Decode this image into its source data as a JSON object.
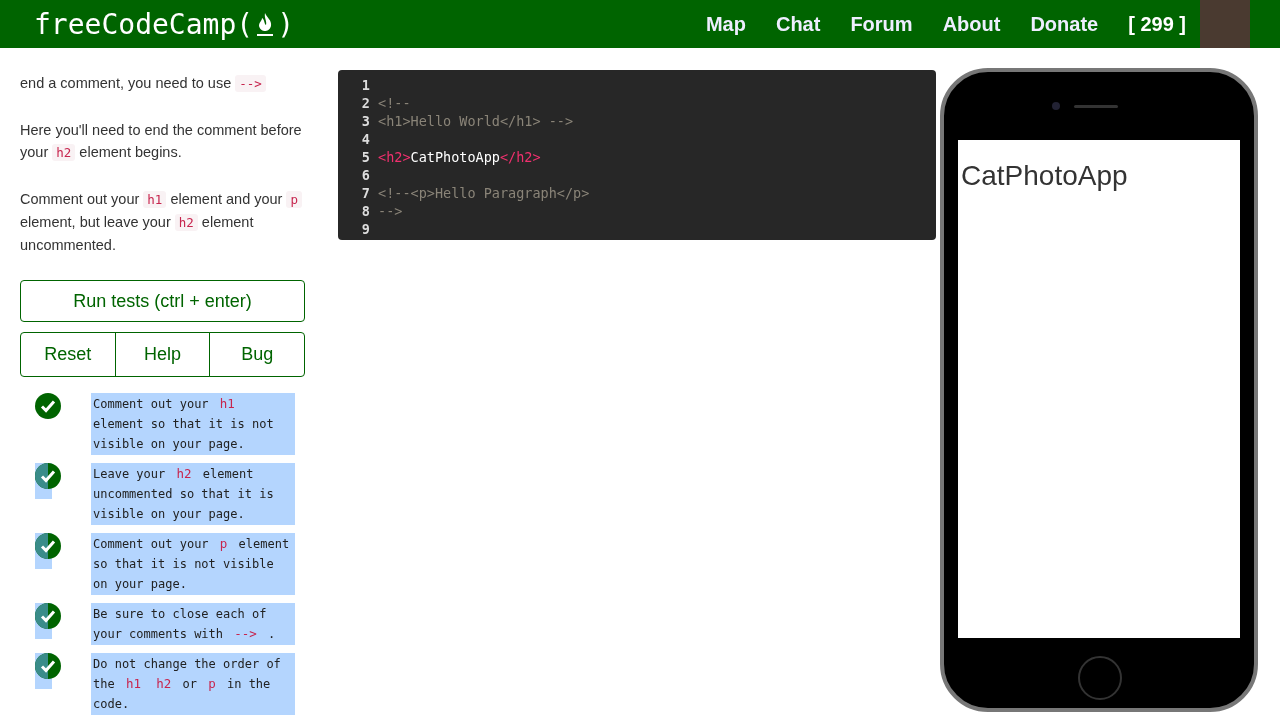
{
  "navbar": {
    "logo": "freeCodeCamp(",
    "logo_end": ")",
    "links": [
      "Map",
      "Chat",
      "Forum",
      "About",
      "Donate"
    ],
    "points": "[ 299 ]"
  },
  "instructions": [
    [
      {
        "kind": "text",
        "text": "end a comment, you need to use"
      },
      {
        "kind": "code",
        "text": "-->"
      }
    ],
    [
      {
        "kind": "text",
        "text": "Here you'll need to end the comment before your"
      },
      {
        "kind": "code",
        "text": "h2"
      },
      {
        "kind": "text",
        "text": "element begins."
      }
    ],
    [
      {
        "kind": "text",
        "text": "Comment out your"
      },
      {
        "kind": "code",
        "text": "h1"
      },
      {
        "kind": "text",
        "text": "element and your"
      },
      {
        "kind": "code",
        "text": "p"
      },
      {
        "kind": "text",
        "text": "element, but leave your"
      },
      {
        "kind": "code",
        "text": "h2"
      },
      {
        "kind": "text",
        "text": "element uncommented."
      }
    ]
  ],
  "buttons": {
    "run": "Run tests (ctrl + enter)",
    "row": [
      "Reset",
      "Help",
      "Bug"
    ]
  },
  "tests": [
    {
      "passed": true,
      "icon_selected": false,
      "selected": true,
      "parts": [
        {
          "kind": "text",
          "text": "Comment out your"
        },
        {
          "kind": "code",
          "text": "h1"
        },
        {
          "kind": "text",
          "text": "element so that it is not visible on your page."
        }
      ]
    },
    {
      "passed": true,
      "icon_selected": true,
      "selected": true,
      "parts": [
        {
          "kind": "text",
          "text": "Leave your"
        },
        {
          "kind": "code",
          "text": "h2"
        },
        {
          "kind": "text",
          "text": "element uncommented so that it is visible on your page."
        }
      ]
    },
    {
      "passed": true,
      "icon_selected": true,
      "selected": true,
      "parts": [
        {
          "kind": "text",
          "text": "Comment out your"
        },
        {
          "kind": "code",
          "text": "p"
        },
        {
          "kind": "text",
          "text": "element so that it is not visible on your page."
        }
      ]
    },
    {
      "passed": true,
      "icon_selected": true,
      "selected": true,
      "parts": [
        {
          "kind": "text",
          "text": "Be sure to close each of your comments with"
        },
        {
          "kind": "code",
          "text": "-->"
        },
        {
          "kind": "text",
          "text": "."
        }
      ]
    },
    {
      "passed": true,
      "icon_selected": true,
      "selected": true,
      "parts": [
        {
          "kind": "text",
          "text": "Do not change the order of the"
        },
        {
          "kind": "code",
          "text": "h1"
        },
        {
          "kind": "code",
          "text": "h2"
        },
        {
          "kind": "text",
          "text": "or"
        },
        {
          "kind": "code",
          "text": "p"
        },
        {
          "kind": "text",
          "text": "in the code."
        }
      ]
    }
  ],
  "editor": {
    "lines": [
      {
        "number": "1"
      },
      {
        "number": "2",
        "tokens": [
          {
            "kind": "comment",
            "text": "<!--"
          }
        ]
      },
      {
        "number": "3",
        "tokens": [
          {
            "kind": "comment",
            "text": "<h1>Hello World</h1> -->"
          }
        ]
      },
      {
        "number": "4"
      },
      {
        "number": "5",
        "tokens": [
          {
            "kind": "tag",
            "text": "<h2>"
          },
          {
            "kind": "text",
            "text": "CatPhotoApp"
          },
          {
            "kind": "tag",
            "text": "</h2>"
          }
        ]
      },
      {
        "number": "6"
      },
      {
        "number": "7",
        "tokens": [
          {
            "kind": "comment",
            "text": "<!--<p>Hello Paragraph</p>"
          }
        ]
      },
      {
        "number": "8",
        "tokens": [
          {
            "kind": "comment",
            "text": "-->"
          }
        ]
      },
      {
        "number": "9"
      }
    ]
  },
  "preview": {
    "heading": "CatPhotoApp"
  }
}
